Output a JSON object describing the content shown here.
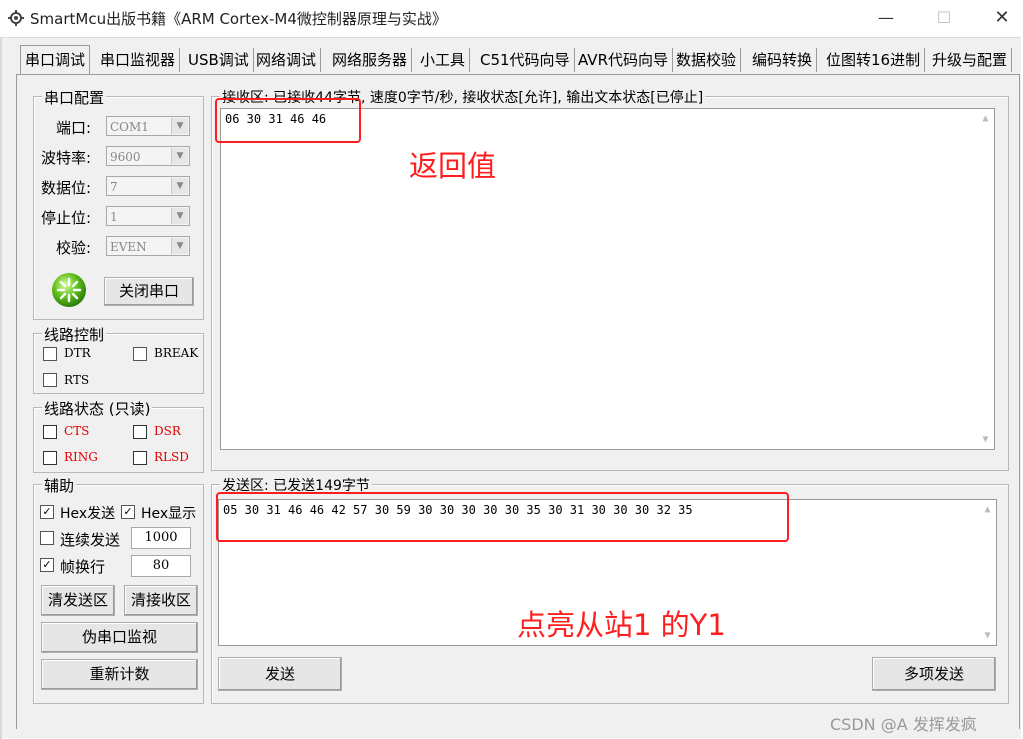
{
  "window": {
    "title": "SmartMcu出版书籍《ARM Cortex-M4微控制器原理与实战》",
    "minimize": "—",
    "maximize": "☐",
    "close": "✕"
  },
  "tabs": [
    {
      "label": "串口调试",
      "active": true
    },
    {
      "label": "串口监视器"
    },
    {
      "label": "USB调试"
    },
    {
      "label": "网络调试"
    },
    {
      "label": "网络服务器"
    },
    {
      "label": "小工具"
    },
    {
      "label": "C51代码向导"
    },
    {
      "label": "AVR代码向导"
    },
    {
      "label": "数据校验"
    },
    {
      "label": "编码转换"
    },
    {
      "label": "位图转16进制"
    },
    {
      "label": "升级与配置"
    }
  ],
  "serial_config": {
    "title": "串口配置",
    "port_label": "端口:",
    "port_value": "COM1",
    "baud_label": "波特率:",
    "baud_value": "9600",
    "databits_label": "数据位:",
    "databits_value": "7",
    "stopbits_label": "停止位:",
    "stopbits_value": "1",
    "parity_label": "校验:",
    "parity_value": "EVEN",
    "close_port_button": "关闭串口"
  },
  "line_control": {
    "title": "线路控制",
    "dtr": "DTR",
    "break": "BREAK",
    "rts": "RTS"
  },
  "line_status": {
    "title": "线路状态 (只读)",
    "cts": "CTS",
    "dsr": "DSR",
    "ring": "RING",
    "rlsd": "RLSD"
  },
  "assist": {
    "title": "辅助",
    "hex_send": "Hex发送",
    "hex_display": "Hex显示",
    "continuous_send": "连续发送",
    "interval_value": "1000",
    "frame_newline": "帧换行",
    "frame_value": "80",
    "clear_send": "清发送区",
    "clear_receive": "清接收区",
    "fake_monitor": "伪串口监视",
    "recount": "重新计数"
  },
  "receive": {
    "title": "接收区: 已接收44字节, 速度0字节/秒, 接收状态[允许], 输出文本状态[已停止]",
    "content": "06 30 31 46 46"
  },
  "send": {
    "title": "发送区: 已发送149字节",
    "content": "05 30 31 46 46 42 57 30 59 30 30 30 30 30 35 30 31 30 30 30 32 35",
    "send_button": "发送",
    "multi_send_button": "多项发送"
  },
  "annotations": {
    "return_value": "返回值",
    "light_y1": "点亮从站1 的Y1",
    "color": "#ff1e1e"
  },
  "watermark": "CSDN @A  发挥发疯"
}
